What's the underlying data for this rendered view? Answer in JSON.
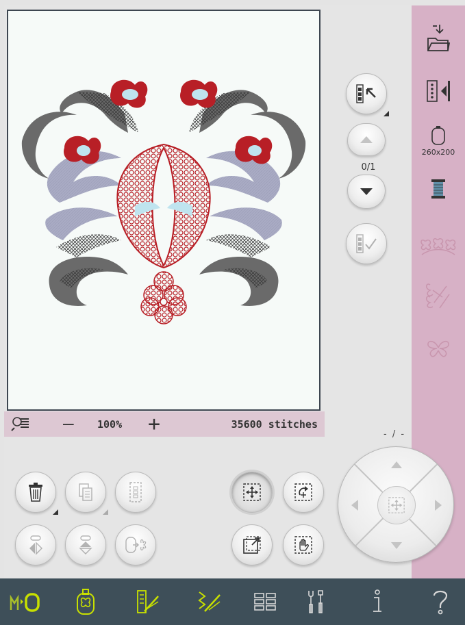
{
  "zoom_bar": {
    "zoom_level": "100%",
    "zoom_out_label": "—",
    "zoom_in_label": "+",
    "stitch_count": "35600 stitches"
  },
  "sidebar": {
    "hoop_label": "260x200"
  },
  "selection": {
    "page_indicator": "0/1",
    "position_readout": "- / -"
  },
  "colors": {
    "sidebar_bg": "#d7b1c6",
    "toolbar_bg": "#3e4f59",
    "toolbar_active": "#c8e000",
    "embroidery_red": "#b81f26",
    "embroidery_gray": "#6a6a6a",
    "embroidery_lavender": "#a9abc4",
    "embroidery_lightblue": "#bfe4ef"
  },
  "icons": {
    "toolbar": [
      "embroidery-mode-toggle-icon",
      "embroidery-edit-icon",
      "design-stitch-icon",
      "stitch-out-icon",
      "menu-grid-icon",
      "settings-tools-icon",
      "info-icon",
      "help-icon"
    ],
    "sidebar": [
      "load-file-icon",
      "align-design-icon",
      "hoop-icon",
      "thread-spool-icon",
      "design-group-icon",
      "stitch-edit-icon",
      "butterfly-icon"
    ]
  }
}
